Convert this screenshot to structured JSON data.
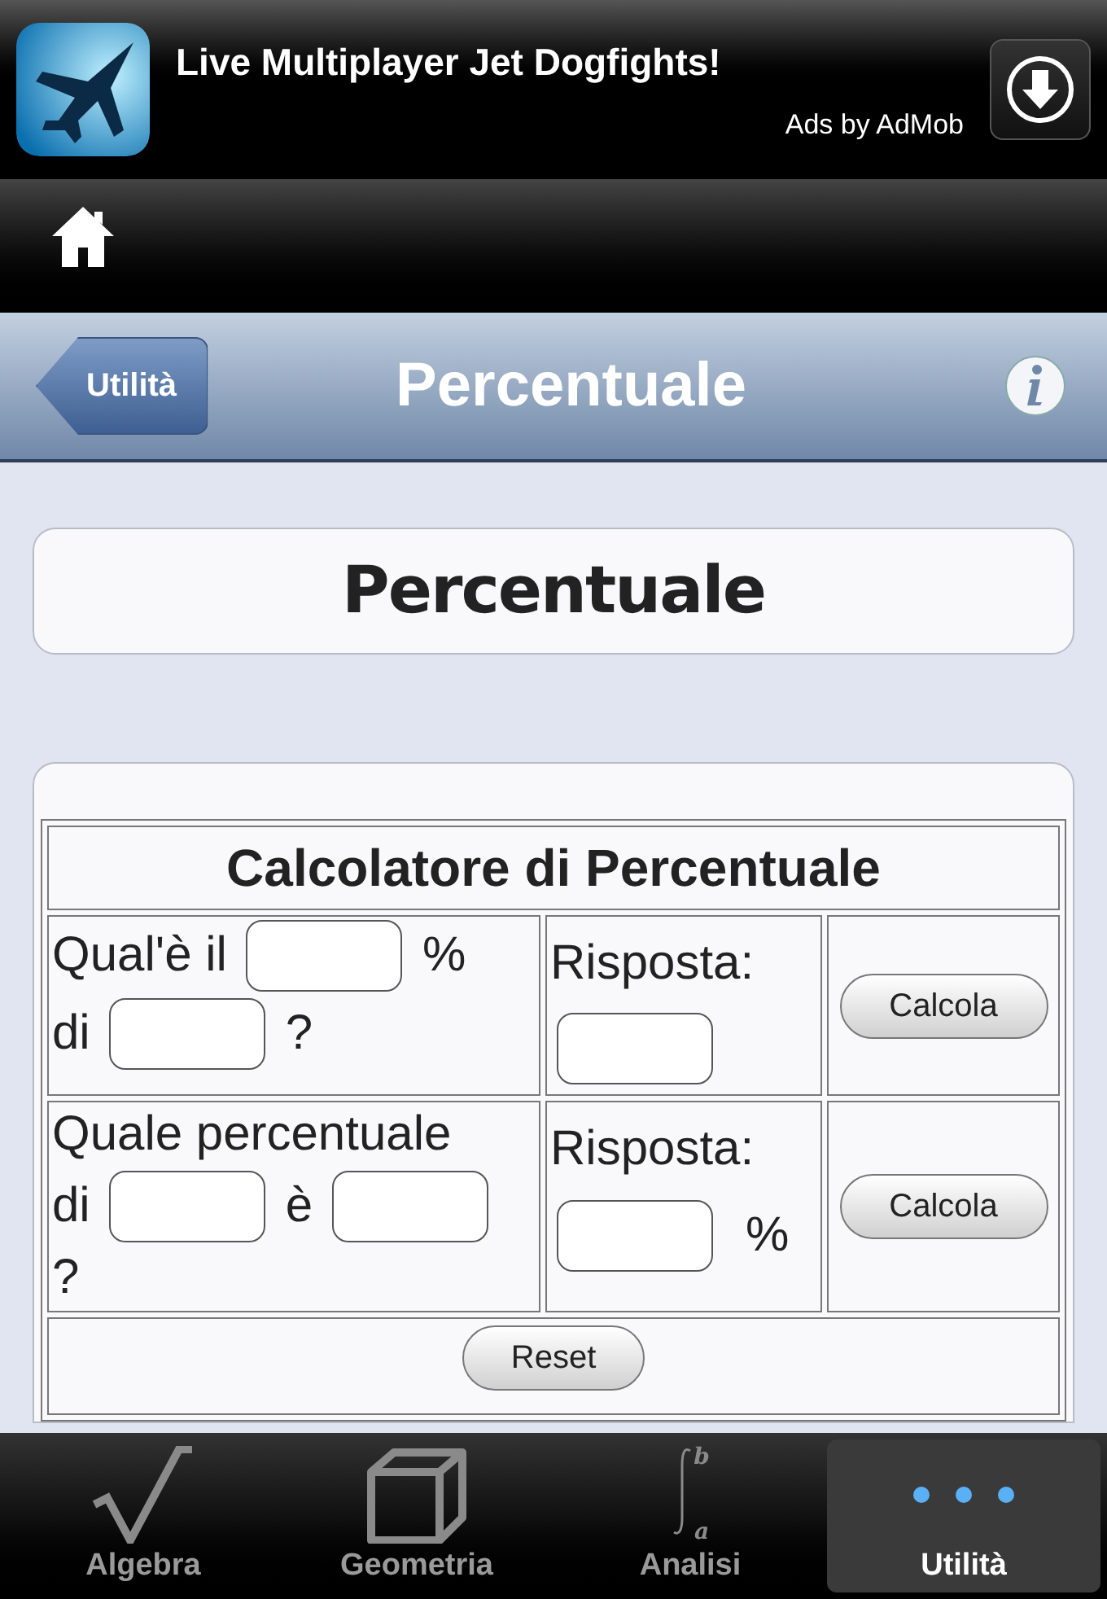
{
  "ad": {
    "headline": "Live Multiplayer Jet Dogfights!",
    "attribution": "Ads by AdMob"
  },
  "nav": {
    "back": "Utilità",
    "title": "Percentuale"
  },
  "page_title": "Percentuale",
  "calculator": {
    "title": "Calcolatore di Percentuale",
    "rows": [
      {
        "question": [
          {
            "kind": "text",
            "text": "Qual'è il"
          },
          {
            "kind": "field"
          },
          {
            "kind": "text",
            "text": "%"
          },
          {
            "kind": "break"
          },
          {
            "kind": "text",
            "text": "di"
          },
          {
            "kind": "field"
          },
          {
            "kind": "text",
            "text": "?"
          }
        ],
        "answer_label": "Risposta:",
        "button": "Calcola"
      },
      {
        "question": [
          {
            "kind": "text",
            "text": "Quale percentuale"
          },
          {
            "kind": "break"
          },
          {
            "kind": "text",
            "text": "di"
          },
          {
            "kind": "field"
          },
          {
            "kind": "text",
            "text": "è"
          },
          {
            "kind": "field"
          },
          {
            "kind": "break"
          },
          {
            "kind": "text",
            "text": "?"
          }
        ],
        "answer_label": "Risposta:",
        "answer_suffix": "%",
        "button": "Calcola"
      }
    ],
    "reset": "Reset"
  },
  "tabs": [
    {
      "label": "Algebra",
      "kind": "sqrt",
      "selected": false
    },
    {
      "label": "Geometria",
      "kind": "cube",
      "selected": false
    },
    {
      "label": "Analisi",
      "kind": "integral",
      "upper": "b",
      "lower": "a",
      "selected": false
    },
    {
      "label": "Utilità",
      "kind": "more",
      "selected": true
    }
  ]
}
